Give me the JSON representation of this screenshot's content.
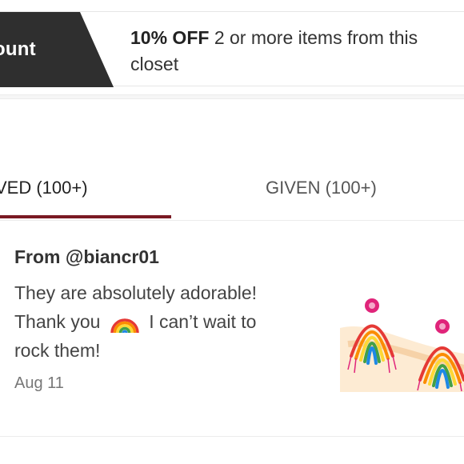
{
  "discount": {
    "tag_label": "ount",
    "bold": "10% OFF",
    "text": "2 or more items from this closet"
  },
  "tabs": {
    "received": "VED (100+)",
    "given": "GIVEN (100+)"
  },
  "review": {
    "from": "From @biancr01",
    "text_before": "They are absolutely adorable! Thank you",
    "emoji": "rainbow-emoji-icon",
    "text_after": "I can’t wait to rock them!",
    "date": "Aug 11"
  },
  "colors": {
    "tag_bg": "#2f2f2f",
    "active_tab_underline": "#7a1a24"
  }
}
